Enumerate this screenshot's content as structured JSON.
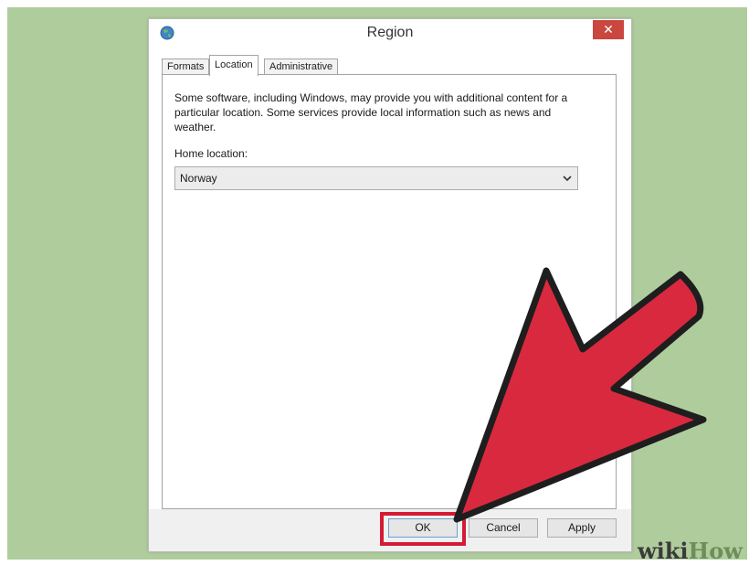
{
  "dialog": {
    "title": "Region",
    "close_glyph": "✕",
    "icon": "globe-icon",
    "tabs": [
      {
        "label": "Formats",
        "active": false
      },
      {
        "label": "Location",
        "active": true
      },
      {
        "label": "Administrative",
        "active": false
      }
    ],
    "location": {
      "description": "Some software, including Windows, may provide you with additional content for a particular location. Some services provide local information such as news and weather.",
      "home_label": "Home location:",
      "home_value": "Norway"
    },
    "buttons": {
      "ok": "OK",
      "cancel": "Cancel",
      "apply": "Apply"
    }
  },
  "annotation": {
    "arrow_color": "#d9293f",
    "highlight_color": "#d51a35"
  },
  "watermark": {
    "part1": "wiki",
    "part2": "How"
  }
}
